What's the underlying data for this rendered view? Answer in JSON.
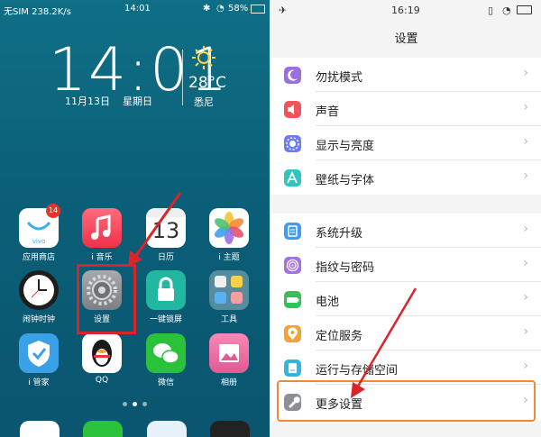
{
  "left": {
    "statusbar": {
      "carrier": "无SIM 238.2K/s",
      "time": "14:01",
      "battery": "58%"
    },
    "clock": {
      "time": "14:01",
      "date": "11月13日",
      "weekday": "星期日"
    },
    "weather": {
      "temp": "28°C",
      "city": "悉尼"
    },
    "apps": [
      {
        "label": "应用商店",
        "badge": "14",
        "icon": "app-store-icon",
        "color": "#ffffff"
      },
      {
        "label": "i 音乐",
        "icon": "music-note-icon",
        "color": "#f6475a"
      },
      {
        "label": "日历",
        "icon": "calendar-icon",
        "color": "#ffffff",
        "day": "13"
      },
      {
        "label": "i 主题",
        "icon": "pinwheel-icon",
        "color": "#ffffff"
      },
      {
        "label": "闹钟时钟",
        "icon": "clock-icon",
        "color": "#222222"
      },
      {
        "label": "设置",
        "icon": "gear-icon",
        "color": "#8a8d91"
      },
      {
        "label": "一键锁屏",
        "icon": "lock-icon",
        "color": "#22b8a0"
      },
      {
        "label": "工具",
        "icon": "folder-icon",
        "color": "#5a8a9a"
      },
      {
        "label": "i 管家",
        "icon": "shield-icon",
        "color": "#3aa0e8"
      },
      {
        "label": "QQ",
        "icon": "qq-penguin-icon",
        "color": "#ffffff"
      },
      {
        "label": "微信",
        "icon": "wechat-icon",
        "color": "#2bc23b"
      },
      {
        "label": "相册",
        "icon": "gallery-icon",
        "color": "#f06ea0"
      }
    ]
  },
  "right": {
    "statusbar": {
      "time": "16:19"
    },
    "title": "设置",
    "group1": [
      {
        "label": "勿扰模式",
        "icon": "moon-icon",
        "color": "#9b6ee6"
      },
      {
        "label": "声音",
        "icon": "speaker-icon",
        "color": "#f2545b"
      },
      {
        "label": "显示与亮度",
        "icon": "brightness-icon",
        "color": "#6d7cf0"
      },
      {
        "label": "壁纸与字体",
        "icon": "font-icon",
        "color": "#31c5c0"
      }
    ],
    "group2": [
      {
        "label": "系统升级",
        "icon": "upgrade-icon",
        "color": "#3f9cf2"
      },
      {
        "label": "指纹与密码",
        "icon": "fingerprint-icon",
        "color": "#a66fe5"
      },
      {
        "label": "电池",
        "icon": "battery-icon",
        "color": "#31c25a"
      },
      {
        "label": "定位服务",
        "icon": "location-icon",
        "color": "#f2a33a"
      },
      {
        "label": "运行与存储空间",
        "icon": "storage-icon",
        "color": "#2fb7e0"
      },
      {
        "label": "更多设置",
        "icon": "wrench-icon",
        "color": "#8c8f94"
      }
    ],
    "chevron": "›"
  }
}
